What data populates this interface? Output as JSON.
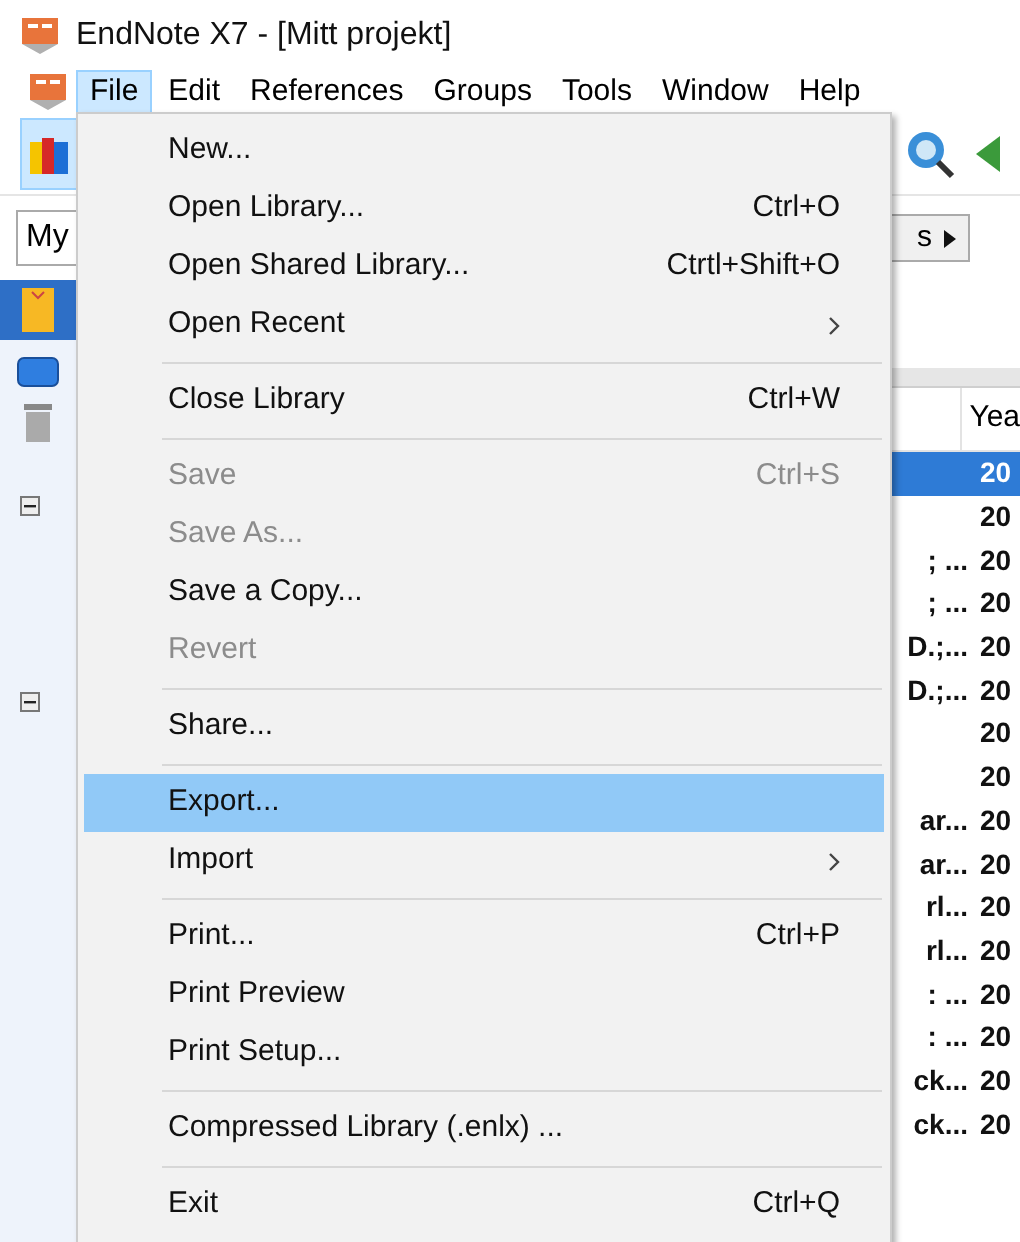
{
  "window": {
    "title": "EndNote X7 - [Mitt projekt]"
  },
  "menu_bar": [
    {
      "label": "File",
      "selected": true
    },
    {
      "label": "Edit",
      "selected": false
    },
    {
      "label": "References",
      "selected": false
    },
    {
      "label": "Groups",
      "selected": false
    },
    {
      "label": "Tools",
      "selected": false
    },
    {
      "label": "Window",
      "selected": false
    },
    {
      "label": "Help",
      "selected": false
    }
  ],
  "library_field": {
    "value": "My"
  },
  "group_button": {
    "label": "s"
  },
  "table": {
    "year_header": "Yea",
    "rows": [
      {
        "year": "20",
        "selected": true
      },
      {
        "year": "20",
        "selected": false
      },
      {
        "author": "; ...",
        "year": "20",
        "selected": false
      },
      {
        "author": "; ...",
        "year": "20",
        "selected": false
      },
      {
        "author": "D.;...",
        "year": "20",
        "selected": false
      },
      {
        "author": "D.;...",
        "year": "20",
        "selected": false
      },
      {
        "year": "20",
        "selected": false
      },
      {
        "year": "20",
        "selected": false
      },
      {
        "author": "ar...",
        "year": "20",
        "selected": false
      },
      {
        "author": "ar...",
        "year": "20",
        "selected": false
      },
      {
        "author": "rl...",
        "year": "20",
        "selected": false
      },
      {
        "author": "rl...",
        "year": "20",
        "selected": false
      },
      {
        "author": ": ...",
        "year": "20",
        "selected": false
      },
      {
        "author": ": ...",
        "year": "20",
        "selected": false
      },
      {
        "author": "ck...",
        "year": "20",
        "selected": false
      },
      {
        "author": "ck...",
        "year": "20",
        "selected": false
      }
    ]
  },
  "file_menu": [
    {
      "kind": "item",
      "label": "New...",
      "disabled": false,
      "selected": false
    },
    {
      "kind": "item",
      "label": "Open Library...",
      "shortcut": "Ctrl+O",
      "disabled": false,
      "selected": false
    },
    {
      "kind": "item",
      "label": "Open Shared Library...",
      "shortcut": "Ctrtl+Shift+O",
      "disabled": false,
      "selected": false
    },
    {
      "kind": "item",
      "label": "Open Recent",
      "submenu": true,
      "disabled": false,
      "selected": false
    },
    {
      "kind": "separator"
    },
    {
      "kind": "item",
      "label": "Close Library",
      "shortcut": "Ctrl+W",
      "disabled": false,
      "selected": false
    },
    {
      "kind": "separator"
    },
    {
      "kind": "item",
      "label": "Save",
      "shortcut": "Ctrl+S",
      "disabled": true,
      "selected": false
    },
    {
      "kind": "item",
      "label": "Save As...",
      "disabled": true,
      "selected": false
    },
    {
      "kind": "item",
      "label": "Save a Copy...",
      "disabled": false,
      "selected": false
    },
    {
      "kind": "item",
      "label": "Revert",
      "disabled": true,
      "selected": false
    },
    {
      "kind": "separator"
    },
    {
      "kind": "item",
      "label": "Share...",
      "disabled": false,
      "selected": false
    },
    {
      "kind": "separator"
    },
    {
      "kind": "item",
      "label": "Export...",
      "disabled": false,
      "selected": true
    },
    {
      "kind": "item",
      "label": "Import",
      "submenu": true,
      "disabled": false,
      "selected": false
    },
    {
      "kind": "separator"
    },
    {
      "kind": "item",
      "label": "Print...",
      "shortcut": "Ctrl+P",
      "disabled": false,
      "selected": false
    },
    {
      "kind": "item",
      "label": "Print Preview",
      "disabled": false,
      "selected": false
    },
    {
      "kind": "item",
      "label": "Print Setup...",
      "disabled": false,
      "selected": false
    },
    {
      "kind": "separator"
    },
    {
      "kind": "item",
      "label": "Compressed Library (.enlx) ...",
      "disabled": false,
      "selected": false
    },
    {
      "kind": "separator"
    },
    {
      "kind": "item",
      "label": "Exit",
      "shortcut": "Ctrl+Q",
      "disabled": false,
      "selected": false
    }
  ]
}
